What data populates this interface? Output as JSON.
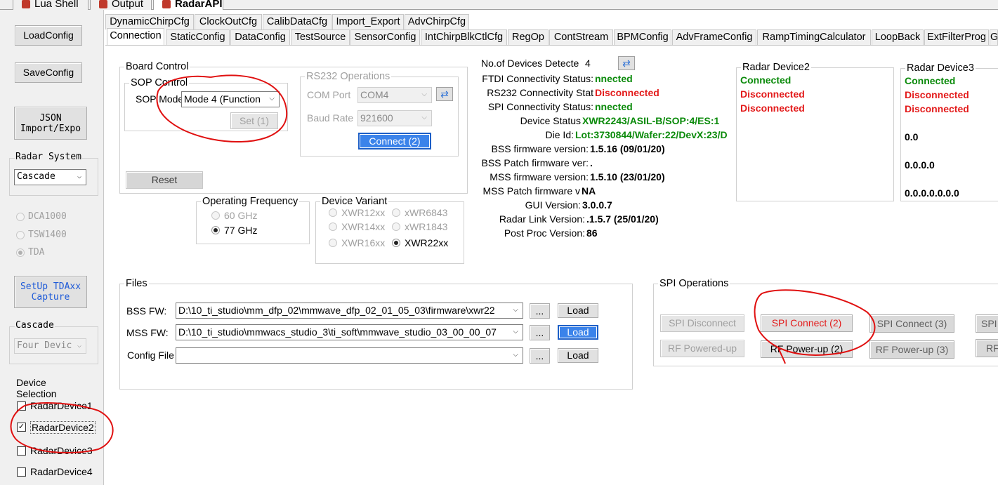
{
  "doc_tabs": [
    "Lua Shell",
    "Output",
    "RadarAPI"
  ],
  "left": {
    "load_config": "LoadConfig",
    "save_config": "SaveConfig",
    "json_import": [
      "JSON",
      "Import/Expo"
    ],
    "radar_system_label": "Radar System",
    "radar_system_value": "Cascade",
    "capture_options": [
      "DCA1000",
      "TSW1400",
      "TDA"
    ],
    "setup_tda": [
      "SetUp TDAxx",
      "Capture"
    ],
    "cascade_label": "Cascade",
    "cascade_value": "Four Devic",
    "device_selection_label": [
      "Device",
      "Selection"
    ],
    "devices": [
      {
        "label": "RadarDevice1",
        "checked": false
      },
      {
        "label": "RadarDevice2",
        "checked": true
      },
      {
        "label": "RadarDevice3",
        "checked": false
      },
      {
        "label": "RadarDevice4",
        "checked": false
      }
    ]
  },
  "tabs_row1": [
    "DynamicChirpCfg",
    "ClockOutCfg",
    "CalibDataCfg",
    "Import_Export",
    "AdvChirpCfg"
  ],
  "tabs_row2": [
    "Connection",
    "StaticConfig",
    "DataConfig",
    "TestSource",
    "SensorConfig",
    "IntChirpBlkCtlCfg",
    "RegOp",
    "ContStream",
    "BPMConfig",
    "AdvFrameConfig",
    "RampTimingCalculator",
    "LoopBack",
    "ExtFilterProg",
    "G"
  ],
  "board_control": {
    "title": "Board Control",
    "sop_title": "SOP Control",
    "sop_mode_label": "SOP Mode",
    "sop_mode_value": "Mode 4 (Function",
    "set_button": "Set (1)",
    "reset_button": "Reset",
    "rs232_title": "RS232 Operations",
    "com_port_label": "COM Port",
    "com_port_value": "COM4",
    "baud_rate_label": "Baud Rate",
    "baud_rate_value": "921600",
    "connect_button": "Connect (2)"
  },
  "operating_frequency": {
    "title": "Operating Frequency",
    "options": [
      "60 GHz",
      "77 GHz"
    ],
    "selected": "77 GHz"
  },
  "device_variant": {
    "title": "Device Variant",
    "options": [
      "XWR12xx",
      "xWR6843",
      "XWR14xx",
      "xWR1843",
      "XWR16xx",
      "XWR22xx"
    ],
    "selected": "XWR22xx"
  },
  "status": {
    "devices_detected_label": "No.of Devices Detecte",
    "devices_detected_value": "4",
    "rows": [
      {
        "label": "FTDI Connectivity Status:",
        "value": "nnected",
        "style": "green"
      },
      {
        "label": "RS232 Connectivity Stat",
        "value": "Disconnected",
        "style": "red"
      },
      {
        "label": "SPI Connectivity Status:",
        "value": "nnected",
        "style": "green"
      },
      {
        "label": "Device Status",
        "value": "XWR2243/ASIL-B/SOP:4/ES:1",
        "style": "green"
      },
      {
        "label": "Die Id:",
        "value": "Lot:3730844/Wafer:22/DevX:23/D",
        "style": "green"
      },
      {
        "label": "BSS firmware version:",
        "value": "1.5.16 (09/01/20)",
        "style": "bold"
      },
      {
        "label": "BSS Patch firmware ver:",
        "value": ".",
        "style": "bold"
      },
      {
        "label": "MSS firmware version:",
        "value": "1.5.10 (23/01/20)",
        "style": "bold"
      },
      {
        "label": "MSS Patch firmware v",
        "value": "NA",
        "style": "bold"
      },
      {
        "label": "GUI Version:",
        "value": "3.0.0.7",
        "style": "bold"
      },
      {
        "label": "Radar Link Version:",
        "value": ".1.5.7 (25/01/20)",
        "style": "bold"
      },
      {
        "label": "Post Proc Version:",
        "value": "86",
        "style": "bold"
      }
    ]
  },
  "radar_device2": {
    "title": "Radar Device2",
    "lines": [
      "Connected",
      "Disconnected",
      "Disconnected"
    ]
  },
  "radar_device3": {
    "title": "Radar Device3",
    "lines": [
      "Connected",
      "Disconnected",
      "Disconnected"
    ],
    "extra": [
      "0.0",
      "0.0.0.0",
      "0.0.0.0.0.0.0"
    ]
  },
  "files": {
    "title": "Files",
    "bss_label": "BSS FW:",
    "bss_value": "D:\\10_ti_studio\\mm_dfp_02\\mmwave_dfp_02_01_05_03\\firmware\\xwr22",
    "mss_label": "MSS FW:",
    "mss_value": "D:\\10_ti_studio\\mmwacs_studio_3\\ti_soft\\mmwave_studio_03_00_00_07",
    "config_label": "Config File",
    "config_value": "",
    "browse": "...",
    "load": "Load"
  },
  "spi": {
    "title": "SPI Operations",
    "spi_disconnect": "SPI Disconnect",
    "rf_powered_up": "RF Powered-up",
    "spi_connect_2": "SPI Connect (2)",
    "rf_powerup_2": "RF Power-up (2)",
    "spi_connect_3": "SPI Connect (3)",
    "rf_powerup_3": "RF Power-up (3)",
    "spi_cut": "SPI",
    "rf_cut": "RF"
  },
  "colors": {
    "connected": "#0a8a0a",
    "disconnected": "#e31b1b",
    "accent": "#3b83ea",
    "annotation": "#e01010"
  }
}
